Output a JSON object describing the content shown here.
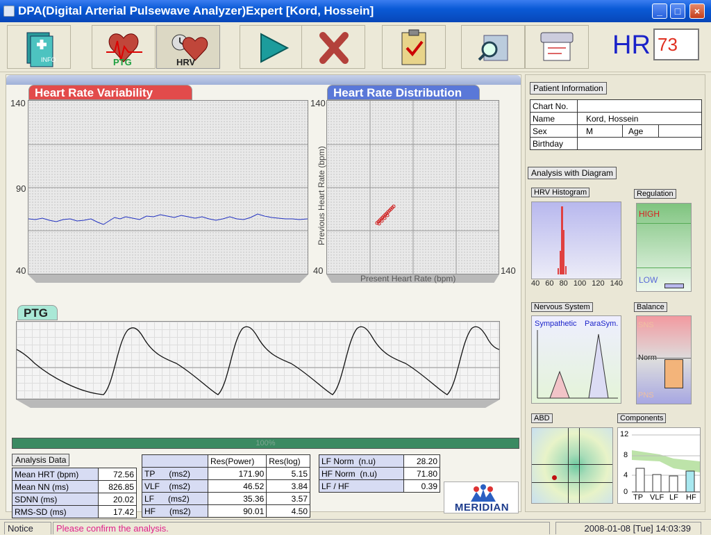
{
  "window": {
    "title": "DPA(Digital Arterial Pulsewave Analyzer)Expert  [Kord, Hossein]",
    "min": "_",
    "max": "□",
    "close": "×"
  },
  "toolbar": {
    "buttons": [
      {
        "name": "info-button",
        "icon": "info-book-icon",
        "label": "INFO"
      },
      {
        "name": "ptg-button",
        "icon": "ptg-heart-icon",
        "label": "PTG"
      },
      {
        "name": "hrv-button",
        "icon": "hrv-clock-heart-icon",
        "label": "HRV",
        "active": true
      },
      {
        "name": "play-button",
        "icon": "play-icon"
      },
      {
        "name": "cancel-button",
        "icon": "x-cross-icon"
      },
      {
        "name": "report-button",
        "icon": "clipboard-check-icon"
      },
      {
        "name": "search-button",
        "icon": "magnifier-map-icon"
      },
      {
        "name": "print-button",
        "icon": "printer-scroll-icon"
      }
    ],
    "hr_label": "HR",
    "hr_value": "73"
  },
  "hrv_chart": {
    "title": "Heart Rate Variability",
    "y_ticks": [
      "140",
      "90",
      "40"
    ]
  },
  "hrd_chart": {
    "title": "Heart Rate Distribution",
    "y_ticks": [
      "140",
      "40"
    ],
    "x_tick_right": "140",
    "xlabel": "Present Heart Rate (bpm)",
    "ylabel": "Previous Heart Rate (bpm)"
  },
  "ptg_chart": {
    "title": "PTG"
  },
  "progress": {
    "label": "100%",
    "value": 1.0
  },
  "analysis": {
    "title": "Analysis Data",
    "rows": [
      {
        "label": "Mean HRT",
        "unit": "(bpm)",
        "value": "72.56"
      },
      {
        "label": "Mean NN",
        "unit": "(ms)",
        "value": "826.85"
      },
      {
        "label": "SDNN",
        "unit": "(ms)",
        "value": "20.02"
      },
      {
        "label": "RMS-SD",
        "unit": "(ms)",
        "value": "17.42"
      }
    ]
  },
  "power": {
    "headers": [
      "",
      "Res(Power)",
      "Res(log)"
    ],
    "rows": [
      {
        "label": "TP",
        "unit": "(ms2)",
        "power": "171.90",
        "log": "5.15"
      },
      {
        "label": "VLF",
        "unit": "(ms2)",
        "power": "46.52",
        "log": "3.84"
      },
      {
        "label": "LF",
        "unit": "(ms2)",
        "power": "35.36",
        "log": "3.57"
      },
      {
        "label": "HF",
        "unit": "(ms2)",
        "power": "90.01",
        "log": "4.50"
      }
    ]
  },
  "norm": {
    "rows": [
      {
        "label": "LF Norm",
        "unit": "(n.u)",
        "value": "28.20"
      },
      {
        "label": "HF Norm",
        "unit": "(n.u)",
        "value": "71.80"
      },
      {
        "label": "LF / HF",
        "unit": "",
        "value": "0.39"
      }
    ]
  },
  "logo": {
    "text": "MERIDIAN"
  },
  "patient": {
    "title": "Patient Information",
    "chart_no_label": "Chart No.",
    "chart_no": "",
    "name_label": "Name",
    "name": "Kord, Hossein",
    "sex_label": "Sex",
    "sex": "M",
    "age_label": "Age",
    "age": "",
    "birthday_label": "Birthday",
    "birthday": ""
  },
  "diagram": {
    "title": "Analysis with Diagram",
    "histogram": {
      "title": "HRV Histogram",
      "ticks": [
        "40",
        "60",
        "80",
        "100",
        "120",
        "140"
      ]
    },
    "regulation": {
      "title": "Regulation",
      "high": "HIGH",
      "low": "LOW"
    },
    "nervous": {
      "title": "Nervous System",
      "sym": "Sympathetic",
      "para": "ParaSym."
    },
    "balance": {
      "title": "Balance",
      "sns": "SNS",
      "norm": "Norm",
      "pns": "PNS"
    },
    "abd": {
      "title": "ABD"
    },
    "components": {
      "title": "Components",
      "y_ticks": [
        "12",
        "8",
        "4",
        "0"
      ],
      "x_ticks": [
        "TP",
        "VLF",
        "LF",
        "HF"
      ]
    }
  },
  "status": {
    "notice_label": "Notice",
    "message": "Please confirm the analysis.",
    "datetime": "2008-01-08 [Tue] 14:03:39"
  },
  "colors": {
    "accent": "#1a22c9",
    "hr_value": "#e03020",
    "progress": "#3b8a62",
    "hrv_tab": "#e04040",
    "hrd_tab": "#5a78d8",
    "ptg_tab": "#3fbf9a"
  }
}
